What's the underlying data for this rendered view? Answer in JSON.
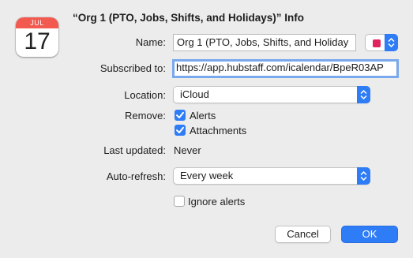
{
  "icon": {
    "month": "JUL",
    "day": "17",
    "name": "calendar-icon"
  },
  "title": "“Org 1 (PTO, Jobs, Shifts, and Holidays)” Info",
  "fields": {
    "name_label": "Name:",
    "name_value": "Org 1 (PTO, Jobs, Shifts, and Holiday",
    "subscribed_label": "Subscribed to:",
    "subscribed_value": "https://app.hubstaff.com/icalendar/BpeR03AP",
    "location_label": "Location:",
    "location_value": "iCloud",
    "remove_label": "Remove:",
    "alerts_label": "Alerts",
    "attachments_label": "Attachments",
    "last_updated_label": "Last updated:",
    "last_updated_value": "Never",
    "autorefresh_label": "Auto-refresh:",
    "autorefresh_value": "Every week",
    "ignore_alerts_label": "Ignore alerts"
  },
  "state": {
    "alerts_checked": true,
    "attachments_checked": true,
    "ignore_alerts_checked": false
  },
  "colors": {
    "calendar_color": "#e0245e",
    "accent": "#2e7cf6",
    "focus_ring": "#79a8ec"
  },
  "buttons": {
    "cancel": "Cancel",
    "ok": "OK"
  }
}
